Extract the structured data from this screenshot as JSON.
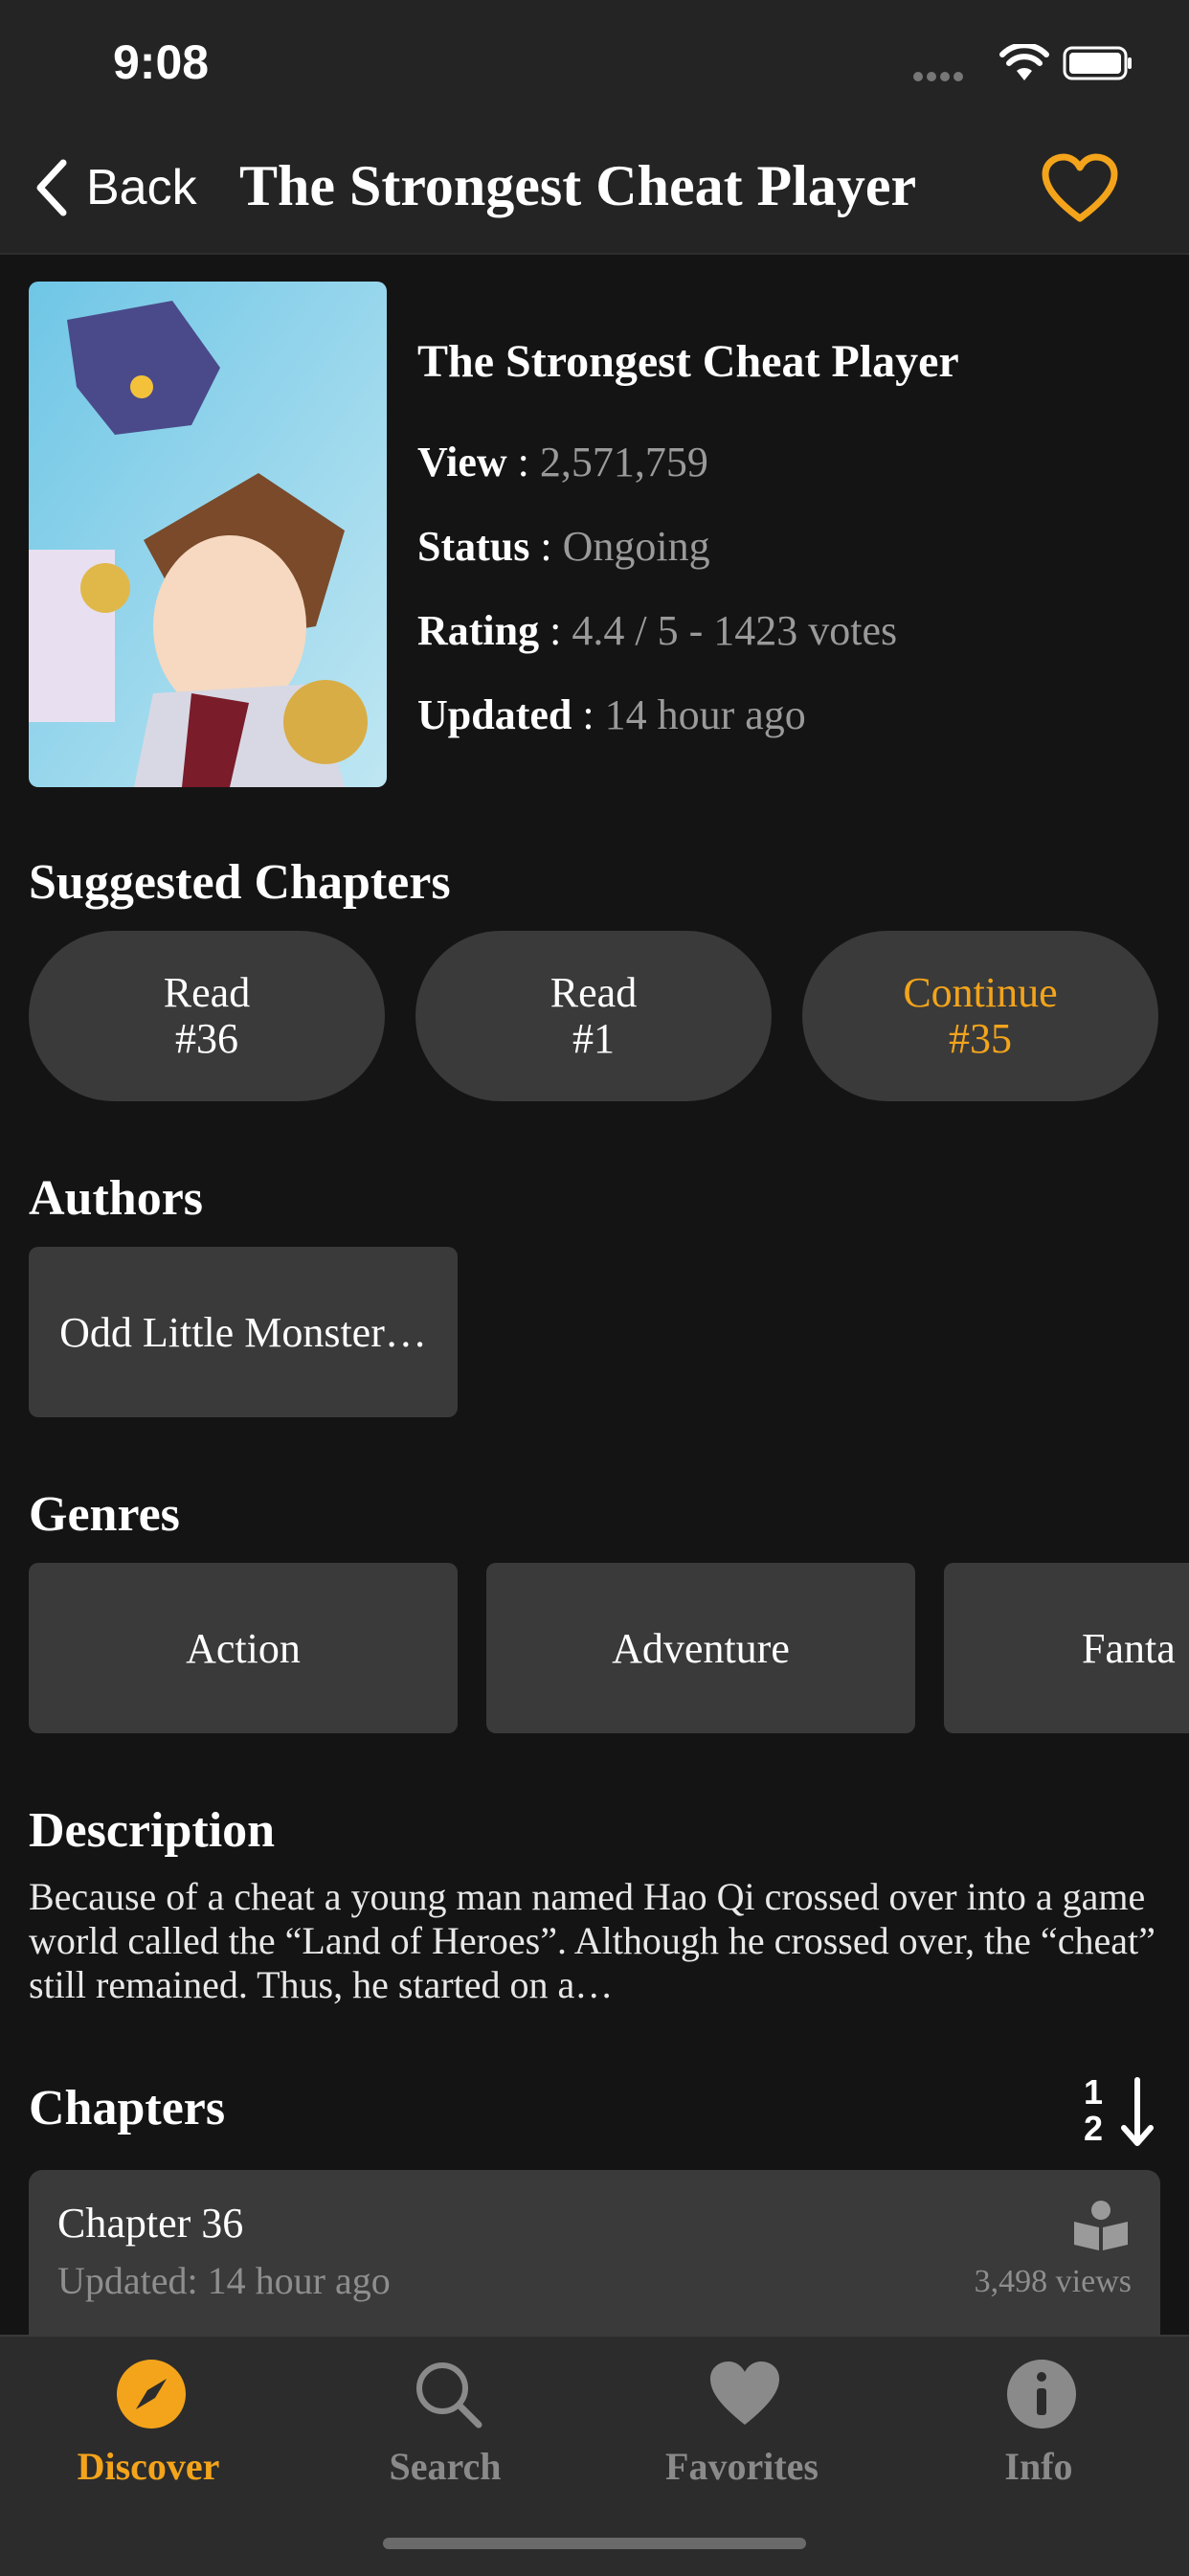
{
  "status_bar": {
    "time": "9:08"
  },
  "nav": {
    "back_label": "Back",
    "title": "The Strongest Cheat Player"
  },
  "manga": {
    "title": "The Strongest Cheat Player",
    "view_label": "View",
    "view_value": "2,571,759",
    "status_label": "Status",
    "status_value": "Ongoing",
    "rating_label": "Rating",
    "rating_value": "4.4 / 5 - 1423 votes",
    "updated_label": "Updated",
    "updated_value": "14 hour ago"
  },
  "suggested": {
    "title": "Suggested Chapters",
    "buttons": [
      {
        "line1": "Read",
        "line2": "#36"
      },
      {
        "line1": "Read",
        "line2": "#1"
      },
      {
        "line1": "Continue",
        "line2": "#35"
      }
    ]
  },
  "authors": {
    "title": "Authors",
    "items": [
      "Odd Little Monster…"
    ]
  },
  "genres": {
    "title": "Genres",
    "items": [
      "Action",
      "Adventure",
      "Fanta"
    ]
  },
  "description": {
    "title": "Description",
    "text": "Because of a cheat a young man named Hao Qi crossed over into a game world called the “Land of Heroes”. Although he crossed over, the “cheat” still remained. Thus, he started on a…"
  },
  "chapters": {
    "title": "Chapters",
    "sort_top": "1",
    "sort_bottom": "2",
    "items": [
      {
        "name": "Chapter 36",
        "updated": "Updated: 14 hour ago",
        "views": "3,498 views"
      }
    ]
  },
  "tabbar": {
    "tabs": [
      {
        "label": "Discover",
        "icon": "compass-icon"
      },
      {
        "label": "Search",
        "icon": "search-icon"
      },
      {
        "label": "Favorites",
        "icon": "heart-icon"
      },
      {
        "label": "Info",
        "icon": "info-icon"
      }
    ]
  },
  "colors": {
    "accent": "#f3a41b",
    "background": "#141414",
    "surface": "#3a3a3a",
    "bar": "#242424"
  }
}
